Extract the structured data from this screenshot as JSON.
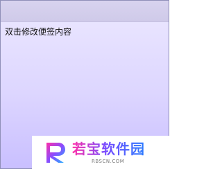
{
  "note": {
    "body_text": "双击修改便签内容"
  },
  "watermark": {
    "title": "若宝软件园",
    "url": "RBSCN.COM",
    "logo_icon": "rbscn-logo-icon"
  }
}
